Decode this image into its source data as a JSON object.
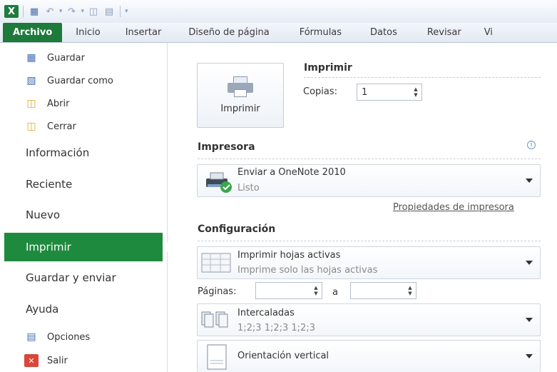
{
  "window": {
    "app_icon_letter": "X"
  },
  "ribbon": {
    "tabs": [
      {
        "label": "Archivo",
        "active": true
      },
      {
        "label": "Inicio"
      },
      {
        "label": "Insertar"
      },
      {
        "label": "Diseño de página"
      },
      {
        "label": "Fórmulas"
      },
      {
        "label": "Datos"
      },
      {
        "label": "Revisar"
      },
      {
        "label": "Vi"
      }
    ]
  },
  "nav": {
    "commands": [
      {
        "label": "Guardar",
        "icon": "save-icon"
      },
      {
        "label": "Guardar como",
        "icon": "save-as-icon"
      },
      {
        "label": "Abrir",
        "icon": "open-folder-icon"
      },
      {
        "label": "Cerrar",
        "icon": "close-folder-icon"
      }
    ],
    "items": [
      "Información",
      "Reciente",
      "Nuevo",
      "Imprimir",
      "Guardar y enviar",
      "Ayuda"
    ],
    "active": "Imprimir",
    "bottom": [
      {
        "label": "Opciones",
        "icon": "options-icon"
      },
      {
        "label": "Salir",
        "icon": "exit-icon"
      }
    ]
  },
  "print": {
    "section_title": "Imprimir",
    "button_label": "Imprimir",
    "copies_label": "Copias:",
    "copies_value": "1"
  },
  "printer": {
    "section_title": "Impresora",
    "name": "Enviar a OneNote 2010",
    "status": "Listo",
    "properties_link": "Propiedades de impresora"
  },
  "settings": {
    "section_title": "Configuración",
    "scope_main": "Imprimir hojas activas",
    "scope_sub": "Imprime solo las hojas activas",
    "pages_label": "Páginas:",
    "pages_from": "",
    "pages_to_label": "a",
    "pages_to": "",
    "collate_main": "Intercaladas",
    "collate_sub": "1;2;3   1;2;3   1;2;3",
    "orientation_main": "Orientación vertical"
  },
  "colors": {
    "accent_green": "#1e8a3e",
    "tab_green": "#1d7a3a",
    "link_gray": "#555555"
  }
}
